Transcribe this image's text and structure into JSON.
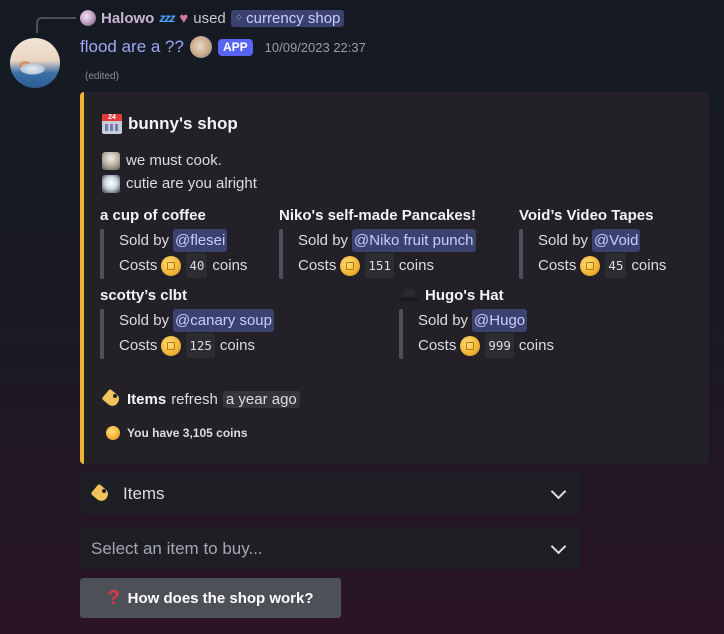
{
  "reply": {
    "username": "Halowo",
    "zzz": "zzz",
    "used_text": "used",
    "command": "currency shop"
  },
  "message": {
    "author": "flood are a ??",
    "badge": "APP",
    "timestamp": "10/09/2023 22:37",
    "edited": "(edited)"
  },
  "embed": {
    "accent_color": "#f0b232",
    "title": "bunny's shop",
    "description": [
      "we must cook.",
      "cutie are you alright"
    ],
    "sold_by_label": "Sold by",
    "costs_label": "Costs",
    "coins_label": "coins",
    "items": [
      {
        "name": "a cup of coffee",
        "seller": "@flesei",
        "price": "40"
      },
      {
        "name": "Niko's self-made Pancakes!",
        "seller": "@Niko fruit punch",
        "price": "151"
      },
      {
        "name": "Void’s Video Tapes",
        "seller": "@Void",
        "price": "45"
      },
      {
        "name": "scotty’s clbt",
        "seller": "@canary soup",
        "price": "125"
      },
      {
        "name": "Hugo's Hat",
        "seller": "@Hugo",
        "price": "999"
      }
    ],
    "footer": {
      "items_label": "Items",
      "refresh_text": "refresh",
      "refresh_time": "a year ago",
      "balance": "You have 3,105 coins"
    }
  },
  "components": {
    "items_select": "Items",
    "buy_select_placeholder": "Select an item to buy...",
    "help_button": "How does the shop work?"
  }
}
